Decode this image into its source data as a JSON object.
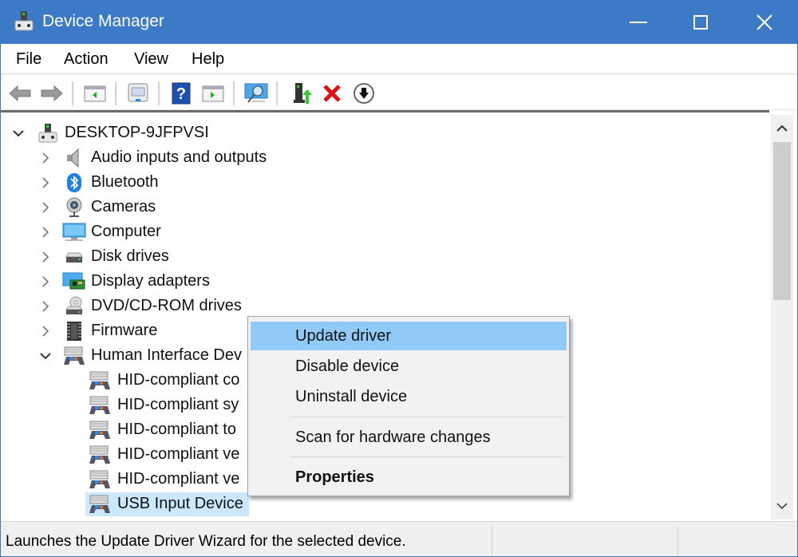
{
  "window": {
    "title": "Device Manager",
    "controls": {
      "minimize": "minimize",
      "maximize": "maximize",
      "close": "close"
    },
    "accent_color": "#3c7ac8"
  },
  "menubar": {
    "items": [
      {
        "label": "File"
      },
      {
        "label": "Action"
      },
      {
        "label": "View"
      },
      {
        "label": "Help"
      }
    ]
  },
  "toolbar": {
    "buttons": [
      {
        "icon": "back-arrow-icon",
        "tooltip": "Back"
      },
      {
        "icon": "forward-arrow-icon",
        "tooltip": "Forward"
      },
      {
        "icon": "show-hide-console-tree-icon",
        "tooltip": "Show/Hide Console Tree"
      },
      {
        "icon": "properties-icon",
        "tooltip": "Properties"
      },
      {
        "icon": "help-icon",
        "tooltip": "Help"
      },
      {
        "icon": "show-hide-action-pane-icon",
        "tooltip": "Show/Hide Action Pane"
      },
      {
        "icon": "scan-hardware-icon",
        "tooltip": "Scan for hardware changes"
      },
      {
        "icon": "update-driver-icon",
        "tooltip": "Update driver"
      },
      {
        "icon": "uninstall-device-icon",
        "tooltip": "Uninstall device"
      },
      {
        "icon": "disable-device-icon",
        "tooltip": "Disable device"
      }
    ]
  },
  "tree": {
    "root": {
      "label": "DESKTOP-9JFPVSI",
      "expanded": true,
      "icon": "computer-root-icon"
    },
    "categories": [
      {
        "label": "Audio inputs and outputs",
        "icon": "speaker-icon",
        "expanded": false
      },
      {
        "label": "Bluetooth",
        "icon": "bluetooth-icon",
        "expanded": false
      },
      {
        "label": "Cameras",
        "icon": "webcam-icon",
        "expanded": false
      },
      {
        "label": "Computer",
        "icon": "monitor-icon",
        "expanded": false
      },
      {
        "label": "Disk drives",
        "icon": "disk-drive-icon",
        "expanded": false
      },
      {
        "label": "Display adapters",
        "icon": "display-adapter-icon",
        "expanded": false
      },
      {
        "label": "DVD/CD-ROM drives",
        "icon": "dvd-drive-icon",
        "expanded": false
      },
      {
        "label": "Firmware",
        "icon": "firmware-chip-icon",
        "expanded": false
      },
      {
        "label": "Human Interface Dev",
        "icon": "hid-icon",
        "expanded": true
      }
    ],
    "hid_children": [
      {
        "label": "HID-compliant co"
      },
      {
        "label": "HID-compliant sy"
      },
      {
        "label": "HID-compliant to"
      },
      {
        "label": "HID-compliant ve"
      },
      {
        "label": "HID-compliant ve"
      },
      {
        "label": "USB Input Device",
        "selected": true
      }
    ]
  },
  "scrollbar": {
    "position_fraction": 0.0,
    "visible_fraction": 0.45
  },
  "context_menu": {
    "items": [
      {
        "label": "Update driver",
        "highlighted": true
      },
      {
        "label": "Disable device"
      },
      {
        "label": "Uninstall device"
      },
      {
        "label": "Scan for hardware changes"
      },
      {
        "label": "Properties",
        "bold": true
      }
    ]
  },
  "statusbar": {
    "text": "Launches the Update Driver Wizard for the selected device."
  }
}
